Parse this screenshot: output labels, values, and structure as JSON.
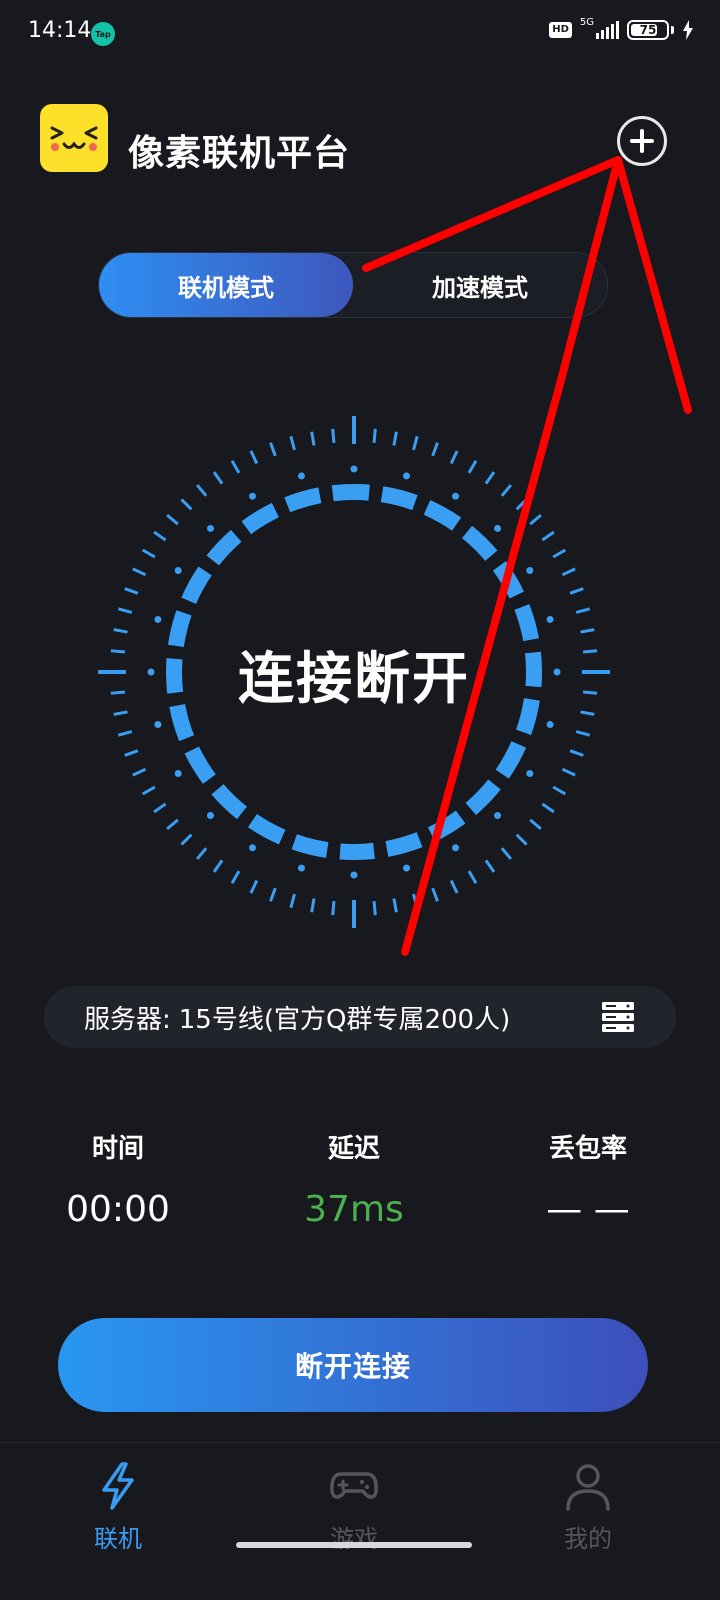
{
  "status_bar": {
    "time": "14:14",
    "app_badge": "Tap",
    "hd_badge": "HD",
    "network": "5G",
    "battery_level": 75,
    "battery_text": "75"
  },
  "header": {
    "title": "像素联机平台"
  },
  "mode_toggle": {
    "tabs": [
      {
        "label": "联机模式",
        "active": true
      },
      {
        "label": "加速模式",
        "active": false
      }
    ]
  },
  "dial": {
    "status": "连接断开",
    "accent_color": "#3a9ff2"
  },
  "server": {
    "prefix": "服务器:",
    "name": "15号线(官方Q群专属200人)"
  },
  "stats": [
    {
      "label": "时间",
      "value": "00:00"
    },
    {
      "label": "延迟",
      "value": "37ms"
    },
    {
      "label": "丢包率",
      "value": "— —"
    }
  ],
  "main_button": {
    "label": "断开连接"
  },
  "bottom_nav": {
    "items": [
      {
        "label": "联机",
        "icon": "lightning-icon",
        "active": true
      },
      {
        "label": "游戏",
        "icon": "gamepad-icon",
        "active": false
      },
      {
        "label": "我的",
        "icon": "user-icon",
        "active": false
      }
    ]
  },
  "colors": {
    "background": "#17191e",
    "accent": "#3a9ff2",
    "latency_good": "#4caf50",
    "annotation": "#ff0000"
  }
}
